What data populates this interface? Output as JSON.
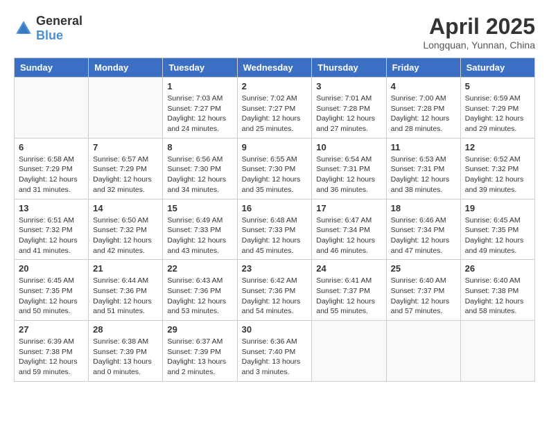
{
  "logo": {
    "general": "General",
    "blue": "Blue"
  },
  "title": {
    "month": "April 2025",
    "location": "Longquan, Yunnan, China"
  },
  "weekdays": [
    "Sunday",
    "Monday",
    "Tuesday",
    "Wednesday",
    "Thursday",
    "Friday",
    "Saturday"
  ],
  "weeks": [
    [
      {
        "day": "",
        "info": ""
      },
      {
        "day": "",
        "info": ""
      },
      {
        "day": "1",
        "info": "Sunrise: 7:03 AM\nSunset: 7:27 PM\nDaylight: 12 hours and 24 minutes."
      },
      {
        "day": "2",
        "info": "Sunrise: 7:02 AM\nSunset: 7:27 PM\nDaylight: 12 hours and 25 minutes."
      },
      {
        "day": "3",
        "info": "Sunrise: 7:01 AM\nSunset: 7:28 PM\nDaylight: 12 hours and 27 minutes."
      },
      {
        "day": "4",
        "info": "Sunrise: 7:00 AM\nSunset: 7:28 PM\nDaylight: 12 hours and 28 minutes."
      },
      {
        "day": "5",
        "info": "Sunrise: 6:59 AM\nSunset: 7:29 PM\nDaylight: 12 hours and 29 minutes."
      }
    ],
    [
      {
        "day": "6",
        "info": "Sunrise: 6:58 AM\nSunset: 7:29 PM\nDaylight: 12 hours and 31 minutes."
      },
      {
        "day": "7",
        "info": "Sunrise: 6:57 AM\nSunset: 7:29 PM\nDaylight: 12 hours and 32 minutes."
      },
      {
        "day": "8",
        "info": "Sunrise: 6:56 AM\nSunset: 7:30 PM\nDaylight: 12 hours and 34 minutes."
      },
      {
        "day": "9",
        "info": "Sunrise: 6:55 AM\nSunset: 7:30 PM\nDaylight: 12 hours and 35 minutes."
      },
      {
        "day": "10",
        "info": "Sunrise: 6:54 AM\nSunset: 7:31 PM\nDaylight: 12 hours and 36 minutes."
      },
      {
        "day": "11",
        "info": "Sunrise: 6:53 AM\nSunset: 7:31 PM\nDaylight: 12 hours and 38 minutes."
      },
      {
        "day": "12",
        "info": "Sunrise: 6:52 AM\nSunset: 7:32 PM\nDaylight: 12 hours and 39 minutes."
      }
    ],
    [
      {
        "day": "13",
        "info": "Sunrise: 6:51 AM\nSunset: 7:32 PM\nDaylight: 12 hours and 41 minutes."
      },
      {
        "day": "14",
        "info": "Sunrise: 6:50 AM\nSunset: 7:32 PM\nDaylight: 12 hours and 42 minutes."
      },
      {
        "day": "15",
        "info": "Sunrise: 6:49 AM\nSunset: 7:33 PM\nDaylight: 12 hours and 43 minutes."
      },
      {
        "day": "16",
        "info": "Sunrise: 6:48 AM\nSunset: 7:33 PM\nDaylight: 12 hours and 45 minutes."
      },
      {
        "day": "17",
        "info": "Sunrise: 6:47 AM\nSunset: 7:34 PM\nDaylight: 12 hours and 46 minutes."
      },
      {
        "day": "18",
        "info": "Sunrise: 6:46 AM\nSunset: 7:34 PM\nDaylight: 12 hours and 47 minutes."
      },
      {
        "day": "19",
        "info": "Sunrise: 6:45 AM\nSunset: 7:35 PM\nDaylight: 12 hours and 49 minutes."
      }
    ],
    [
      {
        "day": "20",
        "info": "Sunrise: 6:45 AM\nSunset: 7:35 PM\nDaylight: 12 hours and 50 minutes."
      },
      {
        "day": "21",
        "info": "Sunrise: 6:44 AM\nSunset: 7:36 PM\nDaylight: 12 hours and 51 minutes."
      },
      {
        "day": "22",
        "info": "Sunrise: 6:43 AM\nSunset: 7:36 PM\nDaylight: 12 hours and 53 minutes."
      },
      {
        "day": "23",
        "info": "Sunrise: 6:42 AM\nSunset: 7:36 PM\nDaylight: 12 hours and 54 minutes."
      },
      {
        "day": "24",
        "info": "Sunrise: 6:41 AM\nSunset: 7:37 PM\nDaylight: 12 hours and 55 minutes."
      },
      {
        "day": "25",
        "info": "Sunrise: 6:40 AM\nSunset: 7:37 PM\nDaylight: 12 hours and 57 minutes."
      },
      {
        "day": "26",
        "info": "Sunrise: 6:40 AM\nSunset: 7:38 PM\nDaylight: 12 hours and 58 minutes."
      }
    ],
    [
      {
        "day": "27",
        "info": "Sunrise: 6:39 AM\nSunset: 7:38 PM\nDaylight: 12 hours and 59 minutes."
      },
      {
        "day": "28",
        "info": "Sunrise: 6:38 AM\nSunset: 7:39 PM\nDaylight: 13 hours and 0 minutes."
      },
      {
        "day": "29",
        "info": "Sunrise: 6:37 AM\nSunset: 7:39 PM\nDaylight: 13 hours and 2 minutes."
      },
      {
        "day": "30",
        "info": "Sunrise: 6:36 AM\nSunset: 7:40 PM\nDaylight: 13 hours and 3 minutes."
      },
      {
        "day": "",
        "info": ""
      },
      {
        "day": "",
        "info": ""
      },
      {
        "day": "",
        "info": ""
      }
    ]
  ]
}
